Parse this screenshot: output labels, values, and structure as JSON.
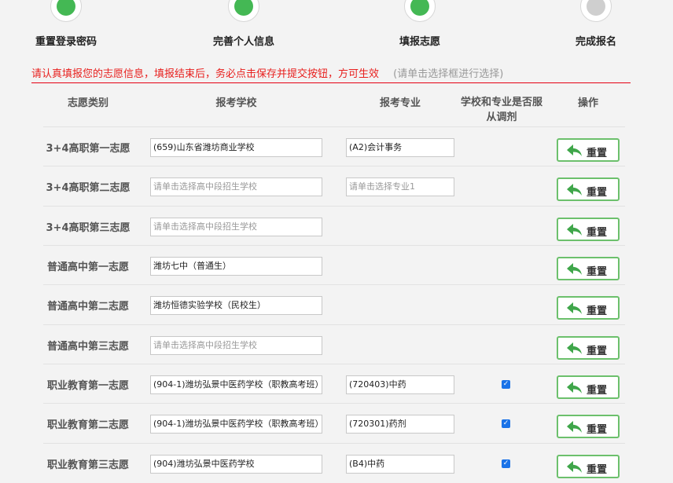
{
  "steps": [
    {
      "label": "重置登录密码",
      "color": "#44b854"
    },
    {
      "label": "完善个人信息",
      "color": "#44b854"
    },
    {
      "label": "填报志愿",
      "color": "#44b854"
    },
    {
      "label": "完成报名",
      "color": "#cfcfcf"
    }
  ],
  "notice": {
    "warning": "请认真填报您的志愿信息，填报结束后，务必点击保存并提交按钮，方可生效",
    "hint": "(请单击选择框进行选择)"
  },
  "table_headers": {
    "type": "志愿类别",
    "school": "报考学校",
    "major": "报考专业",
    "adjust_line1": "学校和专业是否服",
    "adjust_line2": "从调剂",
    "action": "操作"
  },
  "rows": [
    {
      "type": "3+4高职第一志愿",
      "school": "(659)山东省潍坊商业学校",
      "major": "(A2)会计事务",
      "adjust": false
    },
    {
      "type": "3+4高职第二志愿",
      "school": "请单击选择高中段招生学校",
      "major": "请单击选择专业1",
      "adjust": false
    },
    {
      "type": "3+4高职第三志愿",
      "school": "请单击选择高中段招生学校",
      "major": "",
      "adjust": false
    },
    {
      "type": "普通高中第一志愿",
      "school": "潍坊七中（普通生）",
      "major": "",
      "adjust": false
    },
    {
      "type": "普通高中第二志愿",
      "school": "潍坊恒德实验学校（民校生）",
      "major": "",
      "adjust": false
    },
    {
      "type": "普通高中第三志愿",
      "school": "请单击选择高中段招生学校",
      "major": "",
      "adjust": false
    },
    {
      "type": "职业教育第一志愿",
      "school": "(904-1)潍坊弘景中医药学校（职教高考班）",
      "major": "(720403)中药",
      "adjust": true
    },
    {
      "type": "职业教育第二志愿",
      "school": "(904-1)潍坊弘景中医药学校（职教高考班）",
      "major": "(720301)药剂",
      "adjust": true
    },
    {
      "type": "职业教育第三志愿",
      "school": "(904)潍坊弘景中医药学校",
      "major": "(B4)中药",
      "adjust": true
    }
  ],
  "reset_label": "重置",
  "colors": {
    "accent": "#44b854",
    "warning": "#e8201e",
    "button_border": "#6cc06c"
  }
}
